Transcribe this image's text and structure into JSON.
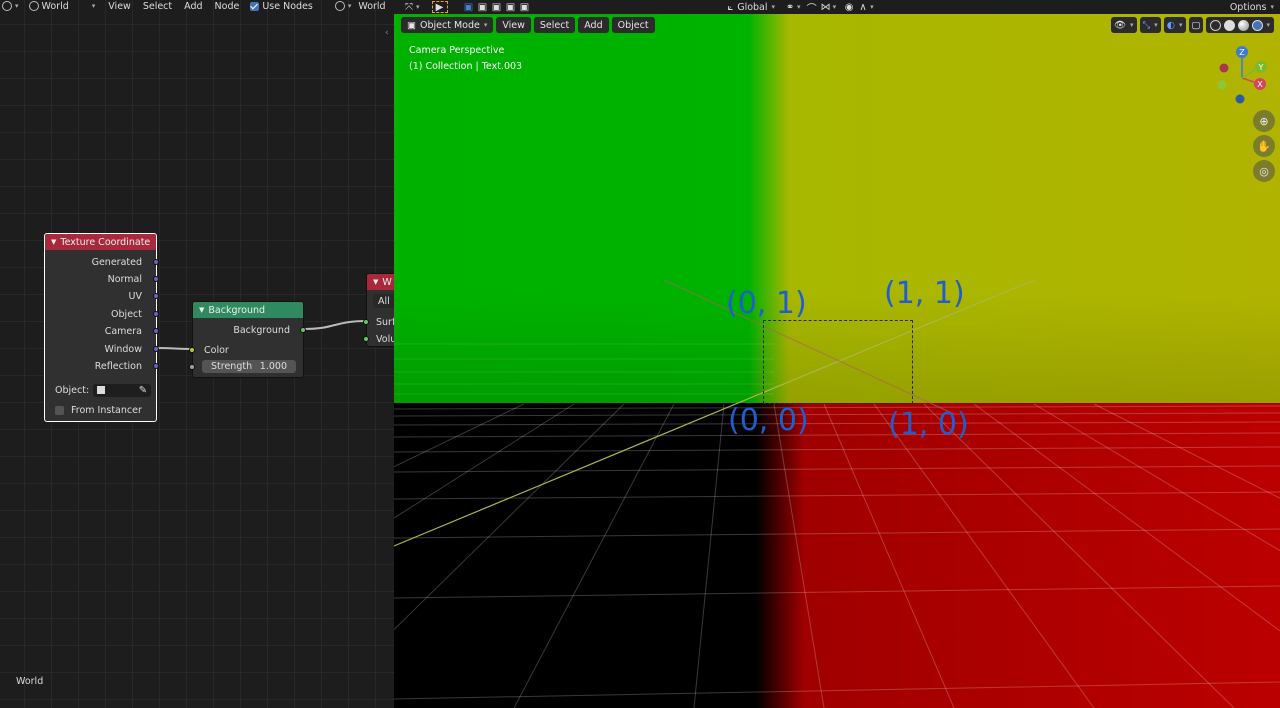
{
  "node_editor": {
    "header": {
      "world_selector": "World",
      "menu": [
        "View",
        "Select",
        "Add",
        "Node"
      ],
      "use_nodes_label": "Use Nodes",
      "world_datablock": "World"
    },
    "tex_coord_node": {
      "title": "Texture Coordinate",
      "outputs": [
        "Generated",
        "Normal",
        "UV",
        "Object",
        "Camera",
        "Window",
        "Reflection"
      ],
      "object_label": "Object:",
      "from_instancer_label": "From Instancer"
    },
    "background_node": {
      "title": "Background",
      "output": "Background",
      "input_color": "Color",
      "strength_label": "Strength",
      "strength_value": "1.000"
    },
    "output_node": {
      "title": "W",
      "target": "All",
      "inputs": [
        "Surf",
        "Volu"
      ]
    },
    "footer_label": "World"
  },
  "viewport": {
    "toolbar_top": {
      "orientation": "Global",
      "options_label": "Options"
    },
    "header": {
      "mode": "Object Mode",
      "menu": [
        "View",
        "Select",
        "Add",
        "Object"
      ]
    },
    "info_line1": "Camera Perspective",
    "info_line2": "(1) Collection | Text.003",
    "gizmo": {
      "z": "Z",
      "y": "Y",
      "x": "X"
    },
    "uv_labels": {
      "top_left": "(0, 1)",
      "top_right": "(1, 1)",
      "bottom_left": "(0, 0)",
      "bottom_right": "(1, 0)"
    }
  },
  "colors": {
    "texcoord_header": "#a8293b",
    "background_header": "#2f8a62",
    "vector_socket": "#6363c7",
    "color_socket": "#c7c729",
    "shader_socket": "#63c763",
    "uv_label": "#1f5ecf"
  }
}
